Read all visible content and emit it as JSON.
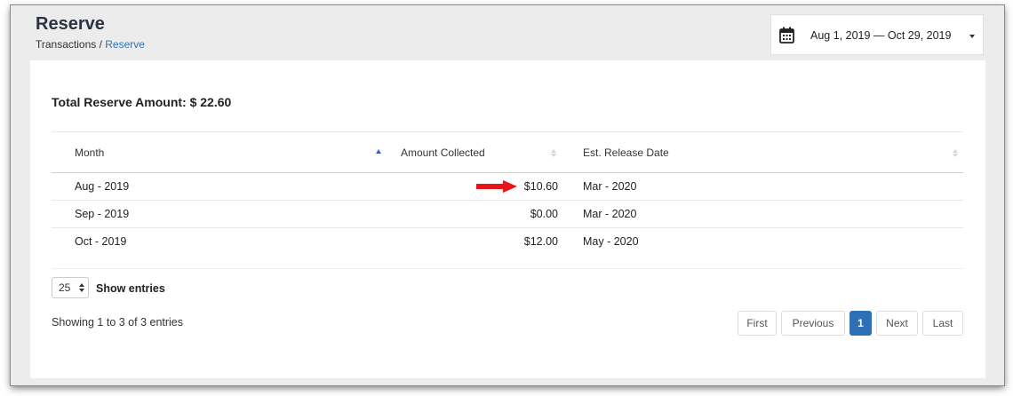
{
  "header": {
    "title": "Reserve",
    "breadcrumb": {
      "parent": "Transactions",
      "separator": " / ",
      "current": "Reserve"
    }
  },
  "date_range": {
    "label": "Aug 1, 2019 — Oct 29, 2019",
    "icon": "calendar-icon"
  },
  "summary": {
    "total_label": "Total Reserve Amount: $ 22.60"
  },
  "table": {
    "columns": [
      "Month",
      "Amount Collected",
      "Est. Release Date"
    ],
    "rows": [
      {
        "month": "Aug - 2019",
        "amount": "$10.60",
        "release": "Mar - 2020"
      },
      {
        "month": "Sep - 2019",
        "amount": "$0.00",
        "release": "Mar - 2020"
      },
      {
        "month": "Oct - 2019",
        "amount": "$12.00",
        "release": "May - 2020"
      }
    ]
  },
  "entries": {
    "value": "25",
    "label": "Show entries"
  },
  "info": "Showing 1 to 3 of 3 entries",
  "pagination": {
    "first": "First",
    "previous": "Previous",
    "current": "1",
    "next": "Next",
    "last": "Last"
  },
  "colors": {
    "accent": "#2f6fb5",
    "annotation_arrow": "#e8141a",
    "background": "#ececec"
  }
}
